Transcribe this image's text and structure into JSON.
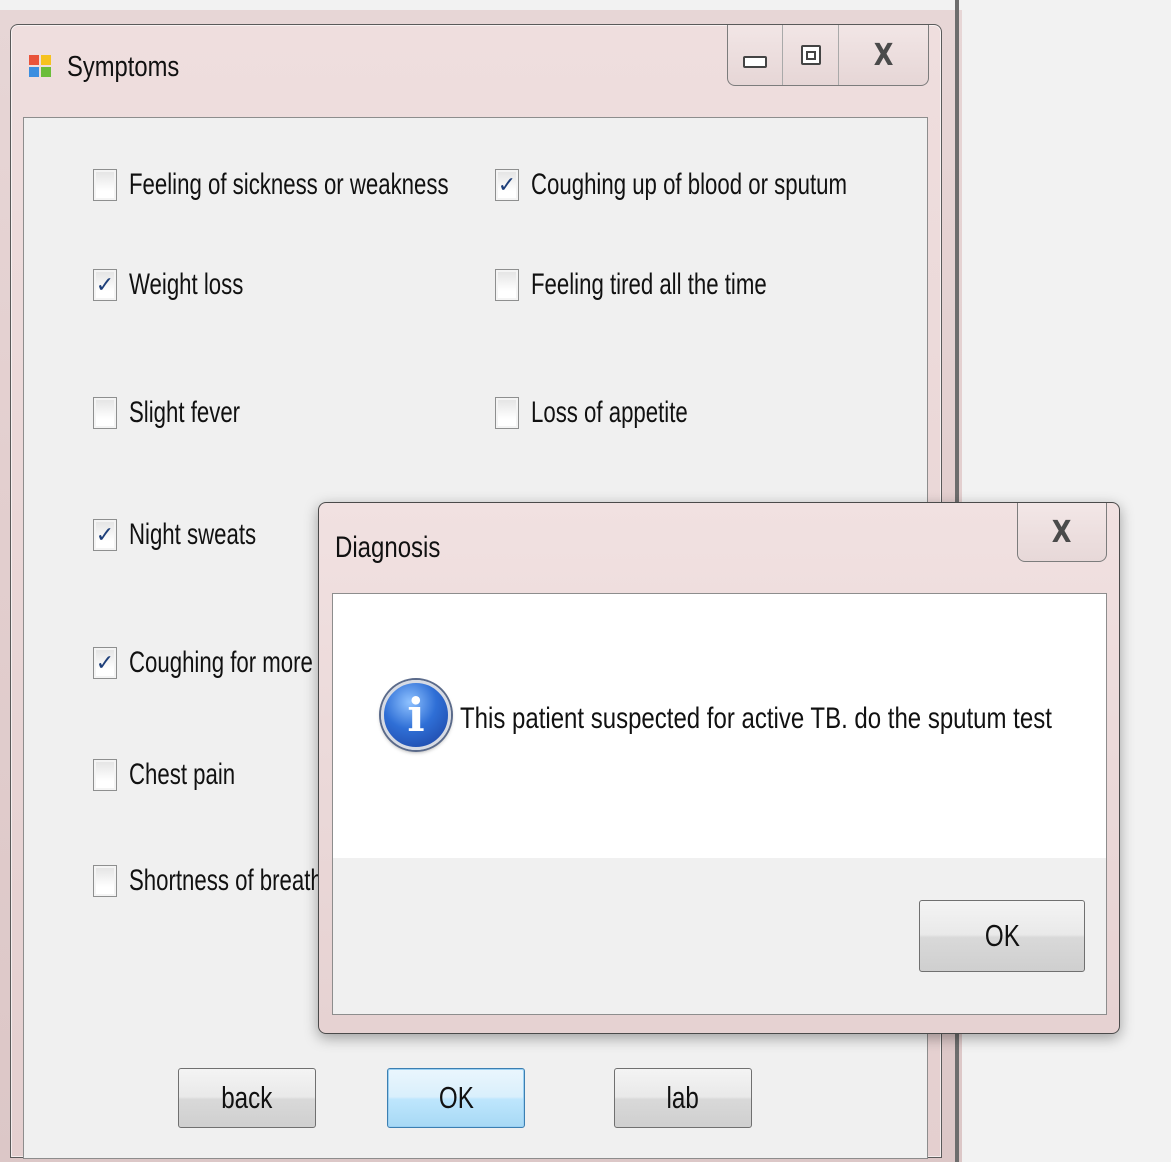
{
  "symptoms_window": {
    "title": "Symptoms",
    "caption": {
      "minimize": "minimize",
      "maximize": "maximize",
      "close": "X"
    },
    "checkboxes": [
      {
        "label": "Feeling of sickness or weakness",
        "checked": false
      },
      {
        "label": "Coughing up of blood or sputum",
        "checked": true
      },
      {
        "label": "Weight loss",
        "checked": true
      },
      {
        "label": "Feeling tired all the time",
        "checked": false
      },
      {
        "label": "Slight fever",
        "checked": false
      },
      {
        "label": "Loss of appetite",
        "checked": false
      },
      {
        "label": "Night sweats",
        "checked": true
      },
      {
        "label": "Coughing for more th",
        "checked": true
      },
      {
        "label": "Chest pain",
        "checked": false
      },
      {
        "label": "Shortness of breath",
        "checked": false
      }
    ],
    "buttons": {
      "back": "back",
      "ok": "OK",
      "lab": "lab"
    }
  },
  "dialog": {
    "title": "Diagnosis",
    "close": "X",
    "message": "This patient suspected for active TB. do the sputum test",
    "icon": "info-icon",
    "ok": "OK"
  },
  "check_mark": "✓"
}
